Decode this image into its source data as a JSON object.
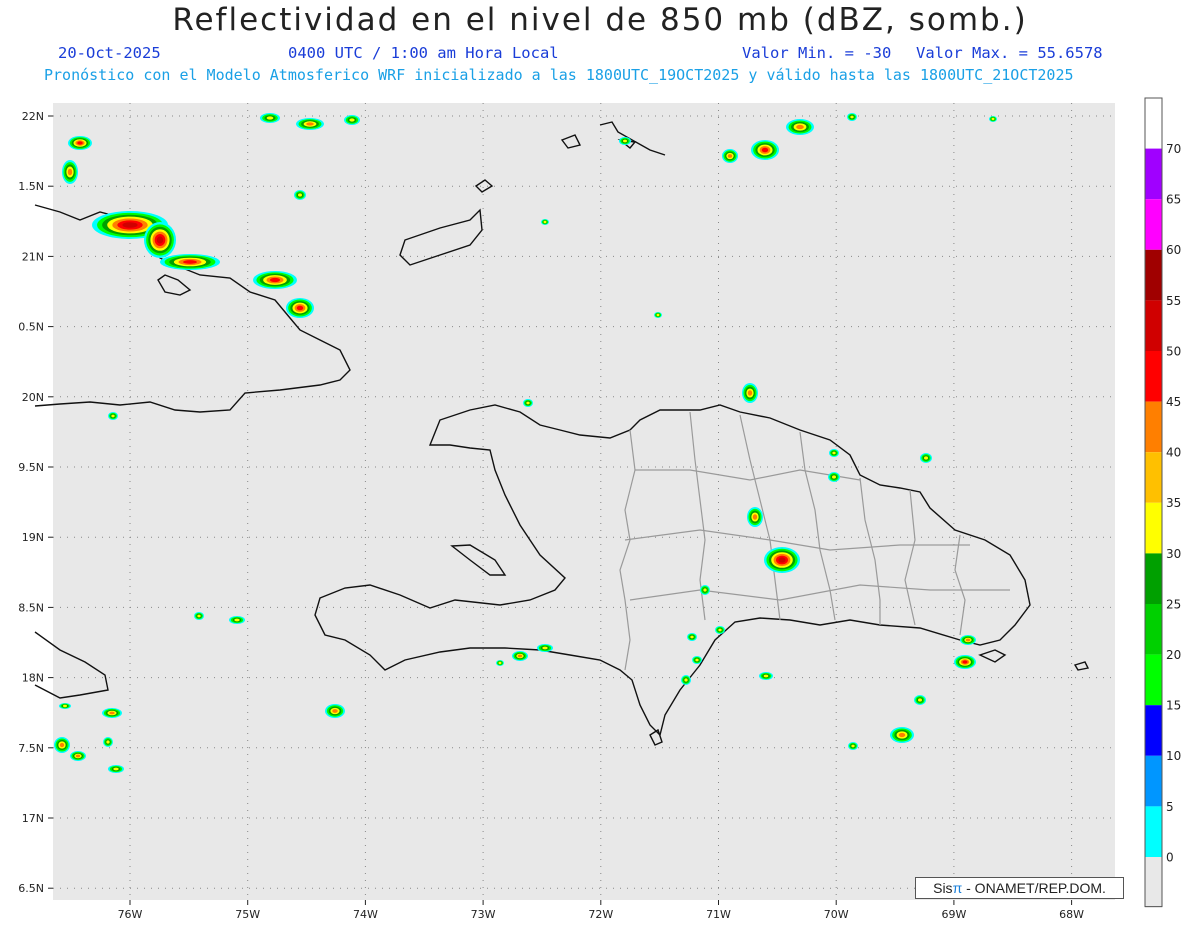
{
  "title": "Reflectividad en el nivel de 850 mb (dBZ, somb.)",
  "date": "20-Oct-2025",
  "time": "0400 UTC / 1:00 am Hora Local",
  "valmin": "Valor Min. = -30",
  "valmax": "Valor Max. = 55.6578",
  "forecast": "Pronóstico con el Modelo Atmosferico WRF inicializado a las 1800UTC_19OCT2025 y válido hasta las  1800UTC_21OCT2025",
  "credit": {
    "sis": "Sis",
    "pi": "π",
    "rest": "- ONAMET/REP.DOM."
  },
  "lat_labels": [
    "22N",
    "1.5N",
    "21N",
    "0.5N",
    "20N",
    "9.5N",
    "19N",
    "8.5N",
    "18N",
    "7.5N",
    "17N",
    "6.5N"
  ],
  "lon_labels": [
    "76W",
    "75W",
    "74W",
    "73W",
    "72W",
    "71W",
    "70W",
    "69W",
    "68W"
  ],
  "colorbar": {
    "labels": [
      "70",
      "65",
      "60",
      "55",
      "50",
      "45",
      "40",
      "35",
      "30",
      "25",
      "20",
      "15",
      "10",
      "5",
      "0"
    ],
    "colors": [
      "#ffffff",
      "#a000ff",
      "#ff00ff",
      "#a00000",
      "#d00000",
      "#ff0000",
      "#ff7f00",
      "#ffc000",
      "#ffff00",
      "#00a000",
      "#00d000",
      "#00ff00",
      "#0000ff",
      "#0096ff",
      "#00ffff",
      "#e8e8e8"
    ]
  }
}
